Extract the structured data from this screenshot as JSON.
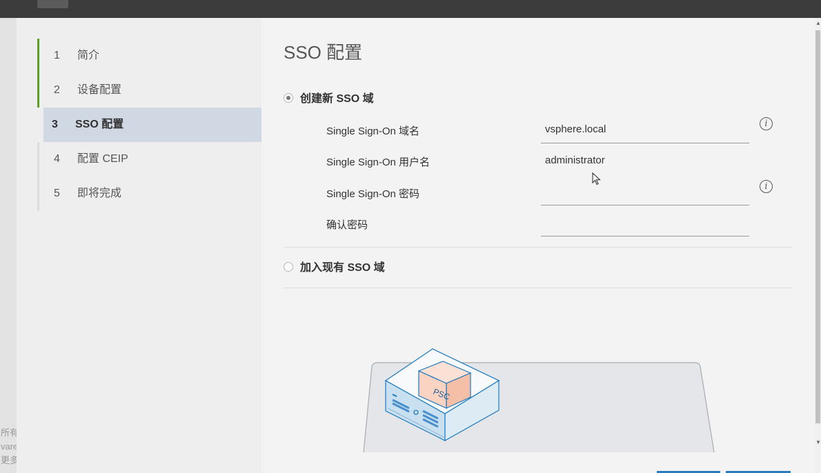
{
  "steps": [
    {
      "num": "1",
      "label": "简介",
      "state": "done"
    },
    {
      "num": "2",
      "label": "设备配置",
      "state": "done"
    },
    {
      "num": "3",
      "label": "SSO 配置",
      "state": "active"
    },
    {
      "num": "4",
      "label": "配置 CEIP",
      "state": "pending"
    },
    {
      "num": "5",
      "label": "即将完成",
      "state": "pending"
    }
  ],
  "page": {
    "title": "SSO 配置",
    "option_new": "创建新 SSO 域",
    "option_join": "加入现有 SSO 域",
    "fields": {
      "domain_label": "Single Sign-On 域名",
      "domain_value": "vsphere.local",
      "user_label": "Single Sign-On 用户名",
      "user_value": "administrator",
      "password_label": "Single Sign-On 密码",
      "password_value": "",
      "confirm_label": "确认密码",
      "confirm_value": ""
    }
  },
  "illustration": {
    "box_label": "PSC"
  },
  "background_text": [
    "所有",
    "vare",
    "更多"
  ],
  "colors": {
    "accent_green": "#5aa220",
    "active_step_bg": "#d0d9e3",
    "illustration_blue": "#1a78bd",
    "illustration_orange": "#f5c4ab"
  }
}
